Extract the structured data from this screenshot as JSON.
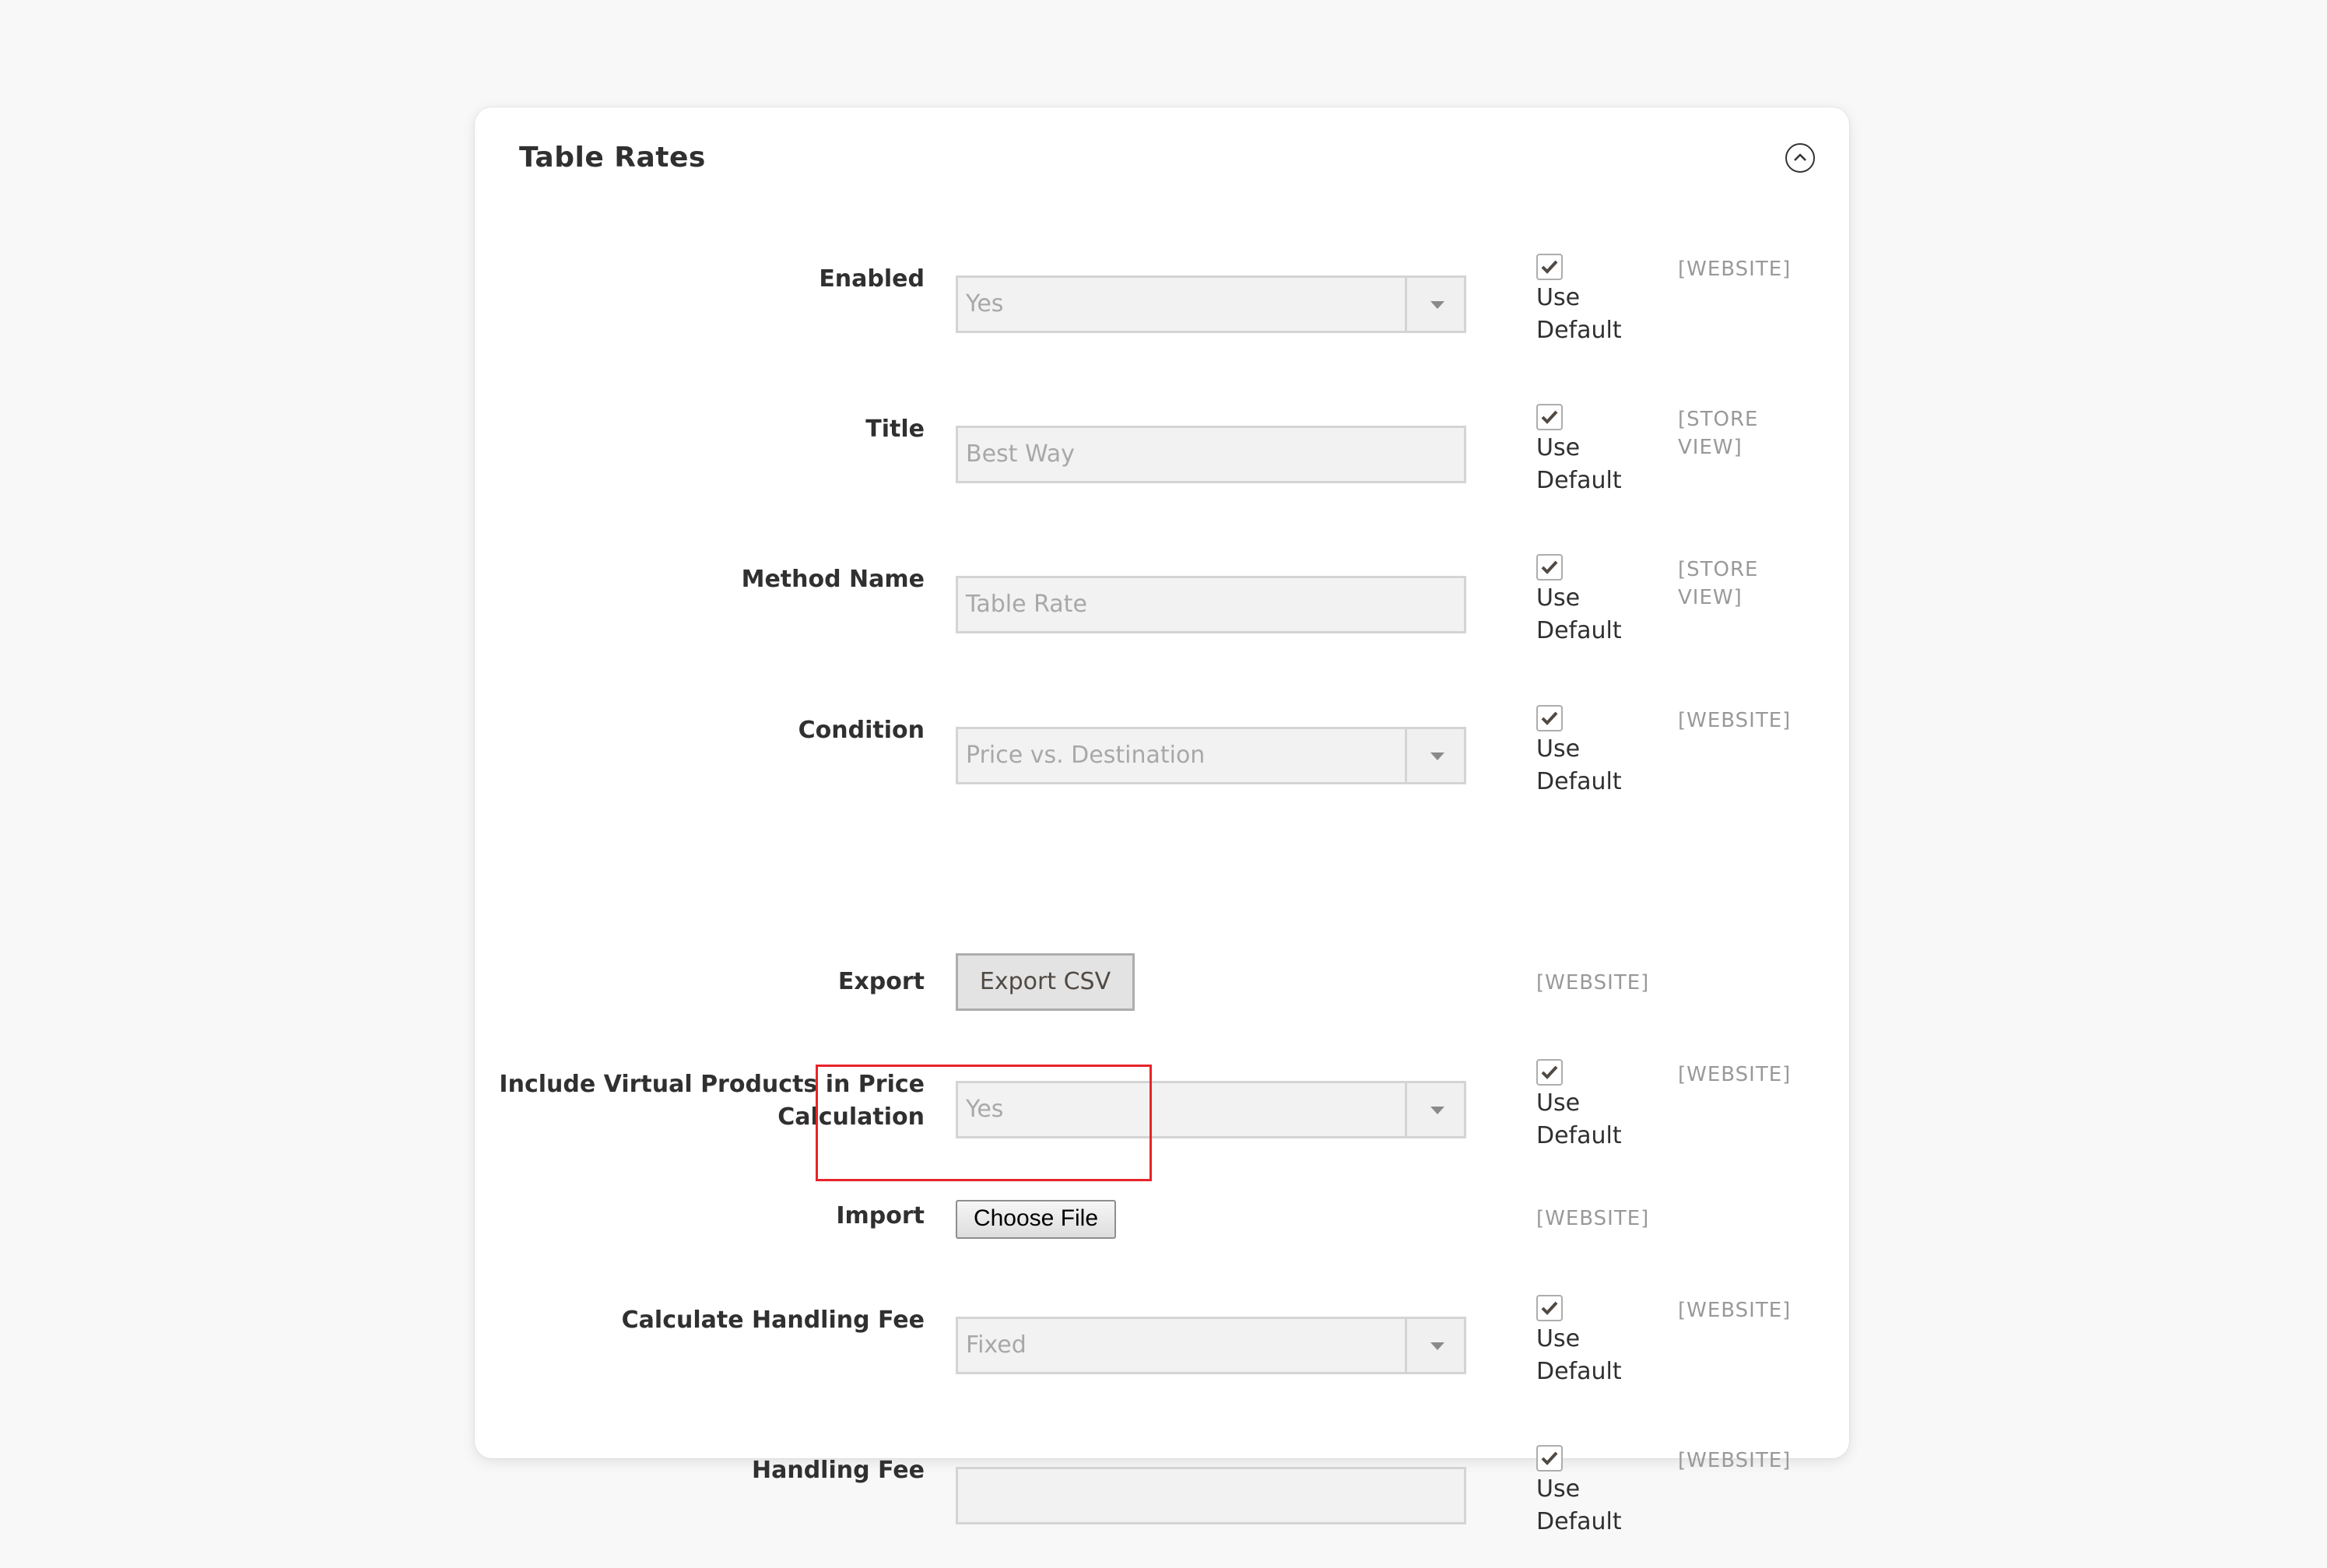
{
  "panel": {
    "title": "Table Rates",
    "collapse_icon": "chevron-up-circle-icon"
  },
  "fields": [
    {
      "label": "Enabled",
      "type": "select",
      "value": "Yes",
      "use_default": true,
      "use_default_label_1": "Use",
      "use_default_label_2": "Default",
      "scope": "[WEBSITE]"
    },
    {
      "label": "Title",
      "type": "text",
      "value": "Best Way",
      "use_default": true,
      "use_default_label_1": "Use",
      "use_default_label_2": "Default",
      "scope_line1": "[STORE",
      "scope_line2": "VIEW]"
    },
    {
      "label": "Method Name",
      "type": "text",
      "value": "Table Rate",
      "use_default": true,
      "use_default_label_1": "Use",
      "use_default_label_2": "Default",
      "scope_line1": "[STORE",
      "scope_line2": "VIEW]"
    },
    {
      "label": "Condition",
      "type": "select",
      "value": "Price vs. Destination",
      "use_default": true,
      "use_default_label_1": "Use",
      "use_default_label_2": "Default",
      "scope": "[WEBSITE]"
    },
    {
      "label": "Export",
      "type": "button",
      "button_label": "Export CSV",
      "scope": "[WEBSITE]"
    },
    {
      "label_line1": "Include Virtual Products in Price",
      "label_line2": "Calculation",
      "type": "select",
      "value": "Yes",
      "use_default": true,
      "use_default_label_1": "Use",
      "use_default_label_2": "Default",
      "scope": "[WEBSITE]"
    },
    {
      "label": "Import",
      "type": "file",
      "button_label": "Choose File",
      "scope": "[WEBSITE]",
      "highlighted": true
    },
    {
      "label": "Calculate Handling Fee",
      "type": "select",
      "value": "Fixed",
      "use_default": true,
      "use_default_label_1": "Use",
      "use_default_label_2": "Default",
      "scope": "[WEBSITE]"
    },
    {
      "label": "Handling Fee",
      "type": "text",
      "value": "",
      "use_default": true,
      "use_default_label_1": "Use",
      "use_default_label_2": "Default",
      "scope": "[WEBSITE]"
    }
  ],
  "colors": {
    "highlight": "#e8242a",
    "scope_text": "#999999",
    "disabled_field_bg": "#f2f2f2"
  }
}
